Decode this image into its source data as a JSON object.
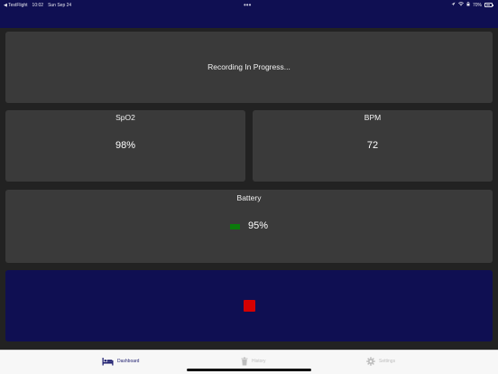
{
  "status_bar": {
    "back_app": "◀ TestFlight",
    "time": "10:02",
    "date": "Sun Sep 24",
    "more_dots": "•••",
    "battery_percent": "70%"
  },
  "status_card": {
    "text": "Recording In Progress..."
  },
  "spo2_card": {
    "label": "SpO2",
    "value": "98%"
  },
  "bpm_card": {
    "label": "BPM",
    "value": "72"
  },
  "battery_card": {
    "label": "Battery",
    "value": "95%",
    "level_color": "#0b7a0b"
  },
  "stop_button": {
    "color": "#d40000"
  },
  "tabs": [
    {
      "label": "Dashboard",
      "icon": "bed-icon",
      "active": true
    },
    {
      "label": "History",
      "icon": "trash-icon",
      "active": false
    },
    {
      "label": "Settings",
      "icon": "gear-icon",
      "active": false
    }
  ],
  "colors": {
    "header_bg": "#0f0f52",
    "page_bg": "#222222",
    "card_bg": "#3a3a3a",
    "tab_active": "#1c1c6e",
    "tab_inactive": "#bdbdbd"
  }
}
